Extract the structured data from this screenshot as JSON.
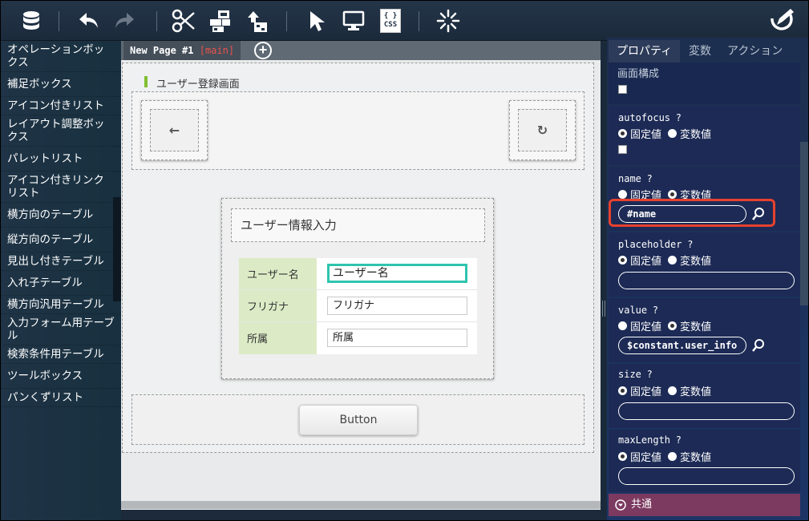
{
  "toolbar": {
    "icons": [
      "database-export-icon",
      "undo-icon",
      "redo-icon",
      "cut-icon",
      "layout-icon",
      "publish-icon",
      "pointer-icon",
      "monitor-preview-icon",
      "css-icon",
      "sparkle-icon",
      "edit-icon"
    ],
    "css_label": "CSS",
    "css_braces": "{ }"
  },
  "left_panel": {
    "items": [
      "オペレーションボックス",
      "補足ボックス",
      "アイコン付きリスト",
      "レイアウト調整ボックス",
      "パレットリスト",
      "アイコン付きリンクリスト",
      "横方向のテーブル",
      "縦方向のテーブル",
      "見出し付きテーブル",
      "入れ子テーブル",
      "横方向汎用テーブル",
      "入力フォーム用テーブル",
      "検索条件用テーブル",
      "ツールボックス",
      "パンくずリスト"
    ]
  },
  "canvas": {
    "tab": {
      "name": "New Page #1",
      "branch": "[main]",
      "add": "+"
    },
    "page_title": "ユーザー登録画面",
    "header": {
      "back_glyph": "←",
      "reload_glyph": "↻"
    },
    "form": {
      "title": "ユーザー情報入力",
      "rows": [
        {
          "label": "ユーザー名",
          "value": "ユーザー名"
        },
        {
          "label": "フリガナ",
          "value": "フリガナ"
        },
        {
          "label": "所属",
          "value": "所属"
        }
      ]
    },
    "button_label": "Button"
  },
  "properties": {
    "tabs": [
      "プロパティ",
      "変数",
      "アクション"
    ],
    "section_label": "画面構成",
    "fixed": "固定値",
    "variable": "変数値",
    "help": "?",
    "props": [
      {
        "name": "autofocus",
        "mode": "fixed"
      },
      {
        "name": "name",
        "mode": "variable",
        "value": "#name"
      },
      {
        "name": "placeholder",
        "mode": "fixed",
        "value": ""
      },
      {
        "name": "value",
        "mode": "variable",
        "value": "$constant.user_info"
      },
      {
        "name": "size",
        "mode": "fixed",
        "value": ""
      },
      {
        "name": "maxLength",
        "mode": "fixed",
        "value": ""
      }
    ],
    "common_label": "共通",
    "highlight_color": "#e8412e"
  }
}
